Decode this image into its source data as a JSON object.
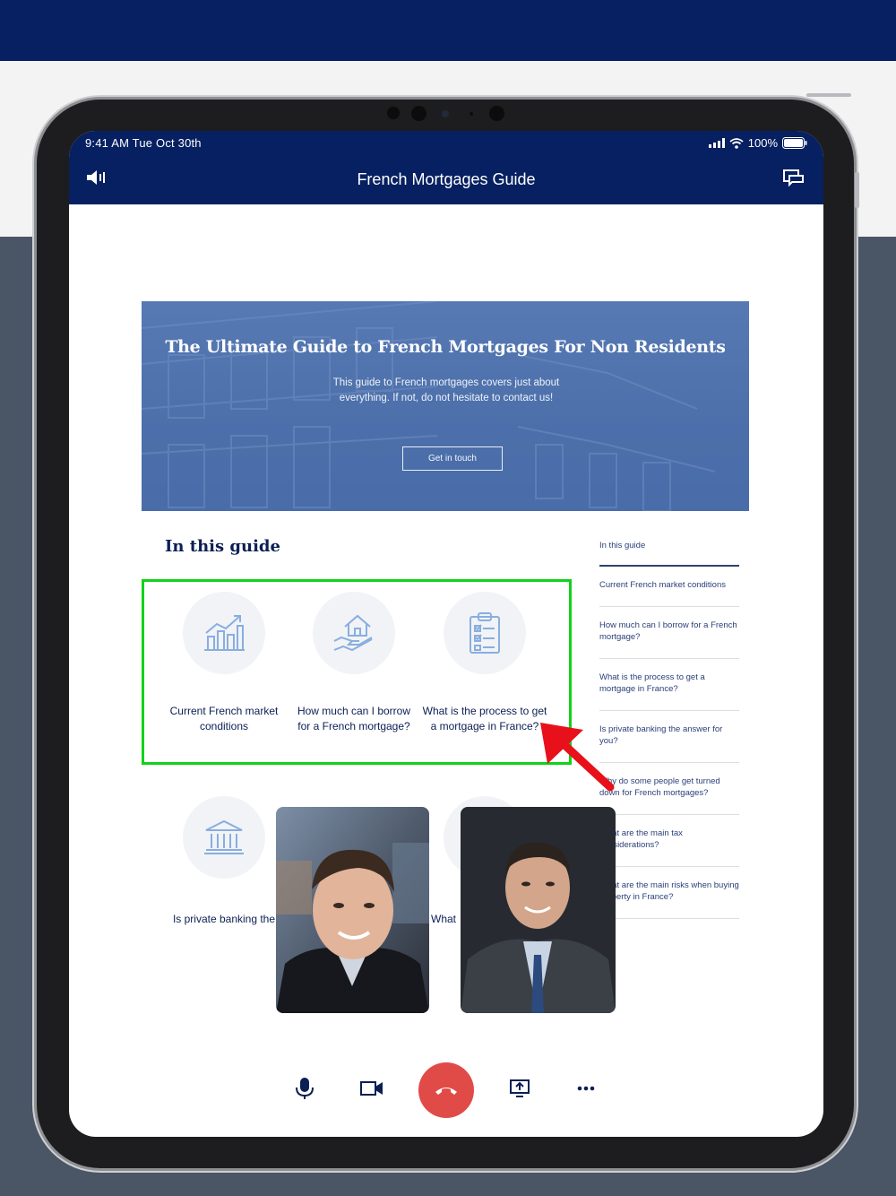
{
  "status_bar": {
    "time": "9:41 AM  Tue Oct 30th",
    "battery": "100%"
  },
  "header": {
    "title": "French Mortgages Guide",
    "left_icon": "speaker-icon",
    "right_icon": "chat-icon"
  },
  "hero": {
    "title": "The Ultimate Guide to French Mortgages For Non Residents",
    "subtitle": "This guide to French mortgages covers just about everything. If not, do not hesitate to contact us!",
    "button": "Get in touch"
  },
  "guide": {
    "heading": "In this guide",
    "cards": [
      {
        "label": "Current French market conditions",
        "icon": "chart-growth-icon"
      },
      {
        "label": "How much can I borrow for a French mortgage?",
        "icon": "house-hand-icon"
      },
      {
        "label": "What is the process to get a mortgage in France?",
        "icon": "clipboard-checklist-icon"
      },
      {
        "label": "Is private banking the answer for you?",
        "icon": "bank-icon"
      },
      {
        "label": "What",
        "icon": ""
      }
    ]
  },
  "toc": {
    "heading": "In this guide",
    "items": [
      "Current French market conditions",
      "How much can I borrow for a French mortgage?",
      "What is the process to get a mortgage in France?",
      "Is private banking the answer for you?",
      "Why do some people get turned down for French mortgages?",
      "What are the main tax considerations?",
      "What are the main risks when buying property in France?"
    ]
  },
  "controls": [
    "microphone-icon",
    "video-camera-icon",
    "hang-up-icon",
    "screen-share-icon",
    "more-icon"
  ],
  "colors": {
    "navy": "#062061",
    "hero_blue": "#4b6ea9",
    "highlight_green": "#10d21a",
    "arrow_red": "#e8101a",
    "hangup_red": "#e14b47"
  }
}
